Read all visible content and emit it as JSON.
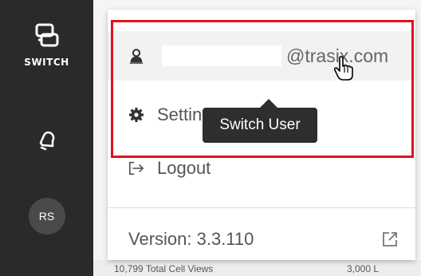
{
  "sidebar": {
    "switch_label": "SWITCH",
    "avatar_initials": "RS"
  },
  "menu": {
    "user_email_domain": "@trasix.com",
    "settings_label": "Settings",
    "logout_label": "Logout",
    "version_label": "Version: 3.3.110"
  },
  "tooltip": {
    "text": "Switch User"
  },
  "background_footer": {
    "left_text": "10,799 Total Cell Views",
    "right_text": "3,000 L"
  },
  "colors": {
    "highlight": "#e0131a",
    "sidebar": "#2a2a2a",
    "tooltip": "#2e2e2e"
  },
  "icons": {
    "switch": "switch-windows-icon",
    "notifications": "bell-icon",
    "user": "user-switch-icon",
    "settings": "gear-icon",
    "logout": "logout-icon",
    "external": "external-link-icon",
    "cursor": "hand-pointer-icon"
  }
}
